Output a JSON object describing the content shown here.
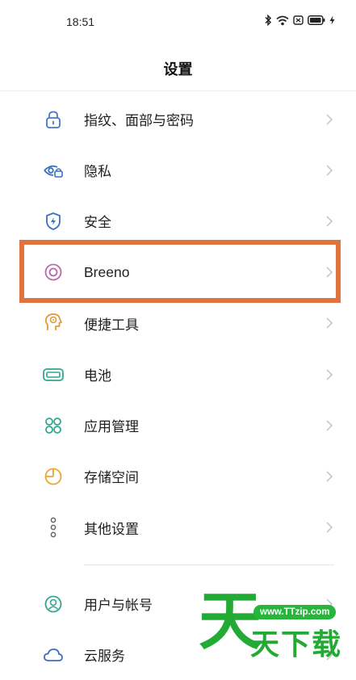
{
  "status_bar": {
    "time": "18:51",
    "icons": [
      "bluetooth-icon",
      "wifi-icon",
      "nfc-icon",
      "battery-icon",
      "charging-icon"
    ]
  },
  "header": {
    "title": "设置"
  },
  "settings": {
    "items": [
      {
        "label": "指纹、面部与密码",
        "icon": "lock-icon",
        "icon_color": "#4a78c9"
      },
      {
        "label": "隐私",
        "icon": "privacy-eye-icon",
        "icon_color": "#3b6fc4"
      },
      {
        "label": "安全",
        "icon": "shield-icon",
        "icon_color": "#3b6fc4"
      },
      {
        "label": "Breeno",
        "icon": "breeno-icon",
        "icon_color": "#b86aa8"
      },
      {
        "label": "便捷工具",
        "icon": "smart-tools-icon",
        "icon_color": "#e99832"
      },
      {
        "label": "电池",
        "icon": "battery-setting-icon",
        "icon_color": "#2fa88f"
      },
      {
        "label": "应用管理",
        "icon": "apps-icon",
        "icon_color": "#2fa88f"
      },
      {
        "label": "存储空间",
        "icon": "storage-icon",
        "icon_color": "#e9a632"
      },
      {
        "label": "其他设置",
        "icon": "more-icon",
        "icon_color": "#666666"
      }
    ],
    "account_items": [
      {
        "label": "用户与帐号",
        "icon": "user-icon",
        "icon_color": "#2fa88f"
      },
      {
        "label": "云服务",
        "icon": "cloud-icon",
        "icon_color": "#3b6fc4"
      }
    ]
  },
  "highlight": {
    "target": "Breeno",
    "color": "#e07440"
  },
  "watermark": {
    "url": "www.TTzip.com",
    "big_char": "天",
    "text": "天下载",
    "color": "#22aa34"
  }
}
